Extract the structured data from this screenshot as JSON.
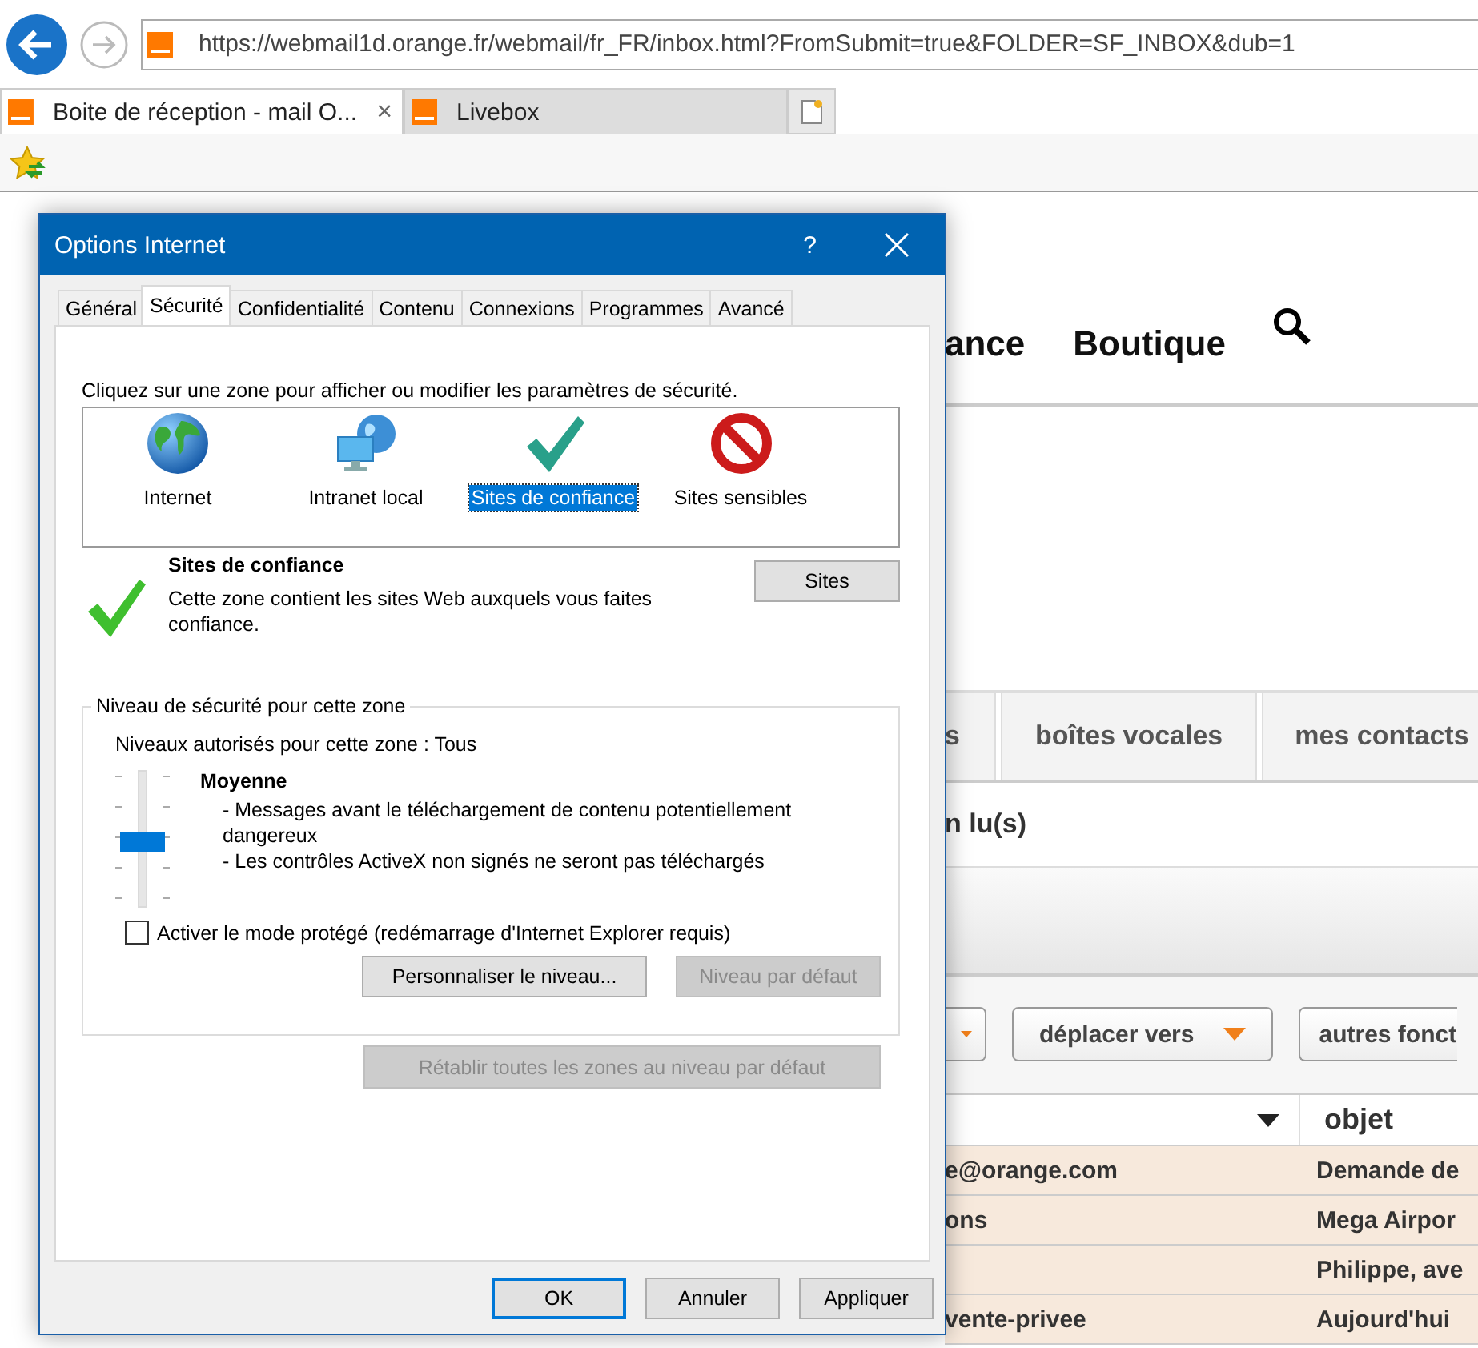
{
  "browser": {
    "address": "https://webmail1d.orange.fr/webmail/fr_FR/inbox.html?FromSubmit=true&FOLDER=SF_INBOX&dub=1",
    "tabs": [
      {
        "title": "Boite de réception - mail O...",
        "selected": true,
        "close": "×"
      },
      {
        "title": "Livebox",
        "selected": false
      }
    ]
  },
  "page": {
    "nav": [
      "ance",
      "Boutique"
    ],
    "tabs": [
      "s",
      "boîtes vocales",
      "mes contacts"
    ],
    "unread": "n lu(s)",
    "toolbar_buttons": [
      "déplacer vers",
      "autres fonct"
    ],
    "table": {
      "columns": [
        "objet"
      ],
      "rows": [
        {
          "from": "e@orange.com",
          "subject": "Demande de"
        },
        {
          "from": "ons",
          "subject": "Mega Airpor"
        },
        {
          "subject": "Philippe, ave"
        },
        {
          "from": "vente-privee",
          "subject": "Aujourd'hui"
        }
      ]
    }
  },
  "dialog": {
    "title": "Options Internet",
    "help": "?",
    "tabs": [
      {
        "label": "Général",
        "selected": false
      },
      {
        "label": "Sécurité",
        "selected": true
      },
      {
        "label": "Confidentialité",
        "selected": false
      },
      {
        "label": "Contenu",
        "selected": false
      },
      {
        "label": "Connexions",
        "selected": false
      },
      {
        "label": "Programmes",
        "selected": false
      },
      {
        "label": "Avancé",
        "selected": false
      }
    ],
    "zone_prompt": "Cliquez sur une zone pour afficher ou modifier les paramètres de sécurité.",
    "zones": [
      {
        "label": "Internet",
        "kind": "internet",
        "selected": false
      },
      {
        "label": "Intranet local",
        "kind": "intranet",
        "selected": false
      },
      {
        "label": "Sites de confiance",
        "kind": "trusted",
        "selected": true
      },
      {
        "label": "Sites sensibles",
        "kind": "restricted",
        "selected": false
      }
    ],
    "zone_info": {
      "title": "Sites de confiance",
      "description": "Cette zone contient les sites Web auxquels vous faites confiance.",
      "button": "Sites"
    },
    "security_level": {
      "legend": "Niveau de sécurité pour cette zone",
      "allowed": "Niveaux autorisés pour cette zone : Tous",
      "level": 0.5,
      "name": "Moyenne",
      "details": [
        "- Messages avant le téléchargement de contenu potentiellement dangereux",
        "- Les contrôles ActiveX non signés ne seront pas téléchargés"
      ]
    },
    "protected_mode": {
      "label": "Activer le mode protégé (redémarrage d'Internet Explorer requis)",
      "checked": false
    },
    "level_buttons": [
      {
        "label": "Personnaliser le niveau...",
        "disabled": false
      },
      {
        "label": "Niveau par défaut",
        "disabled": true
      }
    ],
    "reset_all": {
      "label": "Rétablir toutes les zones au niveau par défaut",
      "disabled": true
    },
    "buttons": [
      {
        "label": "OK",
        "default": true
      },
      {
        "label": "Annuler",
        "default": false
      },
      {
        "label": "Appliquer",
        "default": false
      }
    ]
  }
}
